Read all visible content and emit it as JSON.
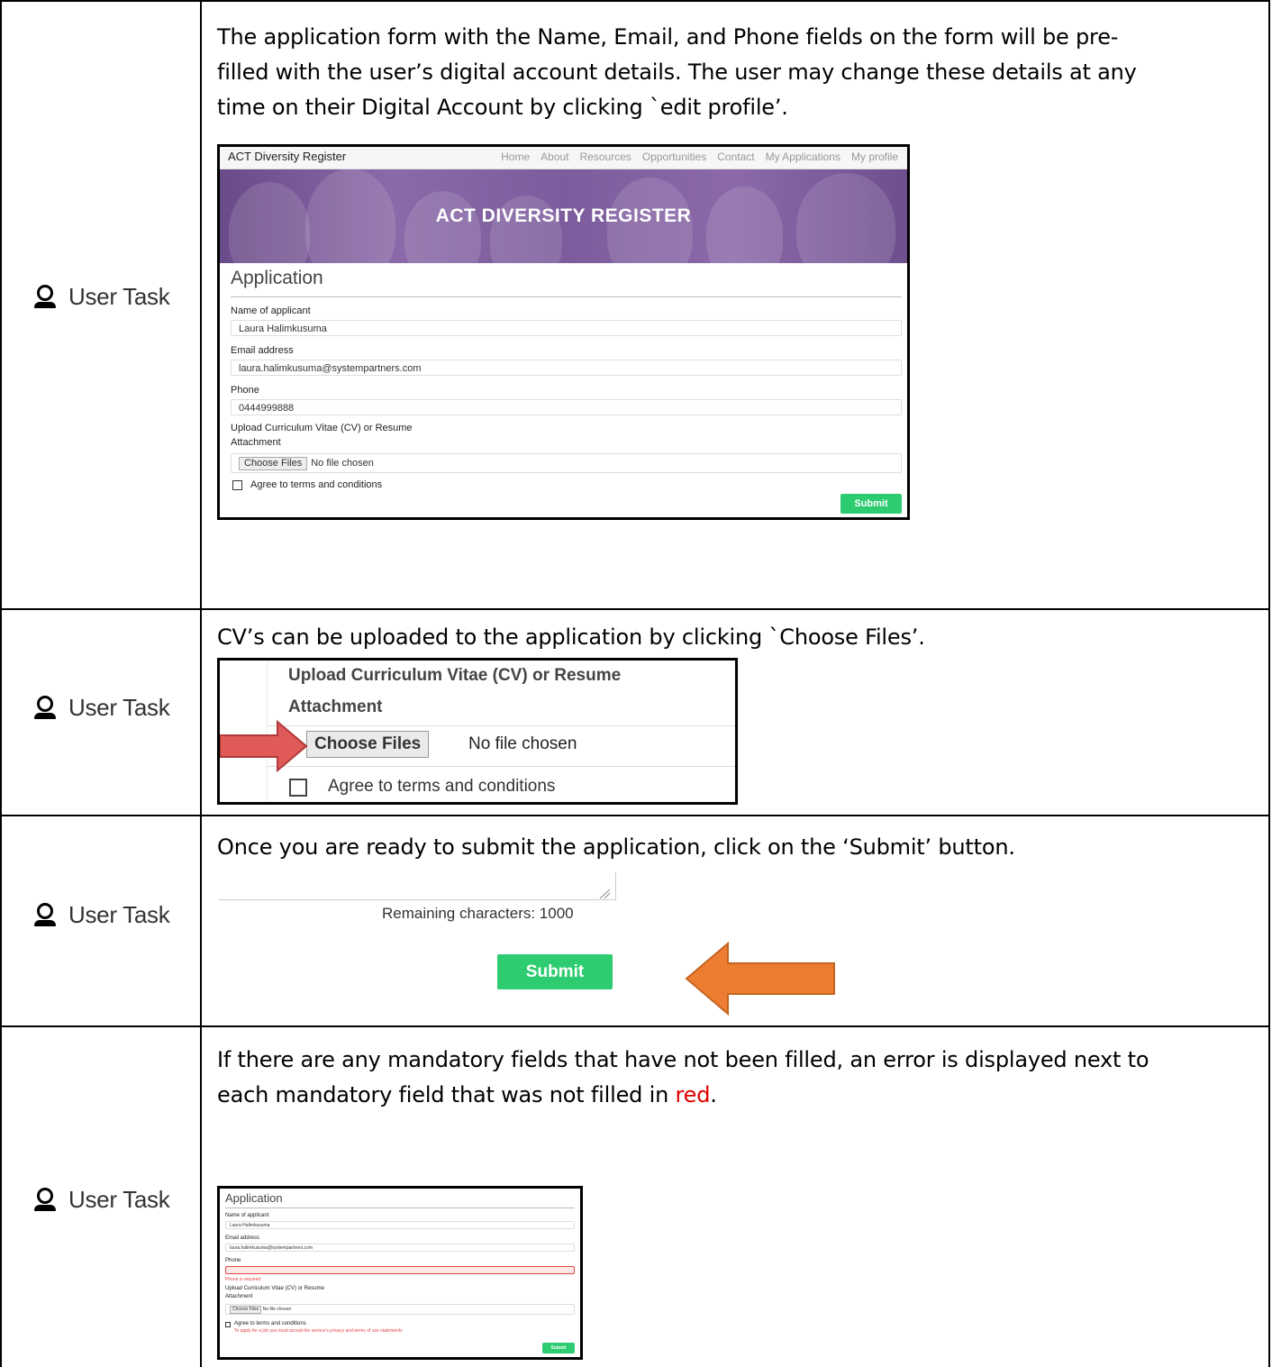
{
  "rows": [
    {
      "task_label": "User Task",
      "text_lines": [
        "The application form with the Name, Email, and Phone fields on the form will be pre-",
        "filled with the user’s digital account details. The user may change these details at any",
        "time on their Digital Account by clicking `edit profile’."
      ]
    },
    {
      "task_label": "User Task",
      "text_lines": [
        "CV’s can be uploaded to the application by clicking `Choose Files’."
      ]
    },
    {
      "task_label": "User Task",
      "text_lines": [
        "Once you are ready to submit the application, click on the ‘Submit’ button."
      ]
    },
    {
      "task_label": "User Task",
      "text_line1": "If there are any mandatory fields that have not been filled, an error is displayed next to",
      "text_line2_pre": "each mandatory field that was not filled in ",
      "text_line2_red": "red",
      "text_line2_post": "."
    }
  ],
  "site": {
    "brand": "ACT Diversity Register",
    "nav": [
      "Home",
      "About",
      "Resources",
      "Opportunities",
      "Contact",
      "My Applications",
      "My profile"
    ],
    "banner_title": "ACT DIVERSITY REGISTER"
  },
  "form": {
    "heading": "Application",
    "name_label": "Name of applicant",
    "name_value": "Laura Halimkusuma",
    "email_label": "Email address",
    "email_value": "laura.halimkusuma@systempartners.com",
    "phone_label": "Phone",
    "phone_value": "0444999888",
    "upload_label": "Upload Curriculum Vitae (CV) or Resume",
    "attachment_label": "Attachment",
    "choose_files": "Choose Files",
    "no_file": "No file chosen",
    "agree": "Agree to terms and conditions",
    "submit": "Submit",
    "remaining": "Remaining characters: 1000",
    "phone_error": "Phone is required",
    "terms_error": "To apply for a job you must accept the service's privacy and terms of use statements"
  },
  "colors": {
    "submit_green": "#2ecc71",
    "arrow_red": "#e05a5a",
    "arrow_orange": "#ed7d31",
    "error_red": "#e64646"
  }
}
